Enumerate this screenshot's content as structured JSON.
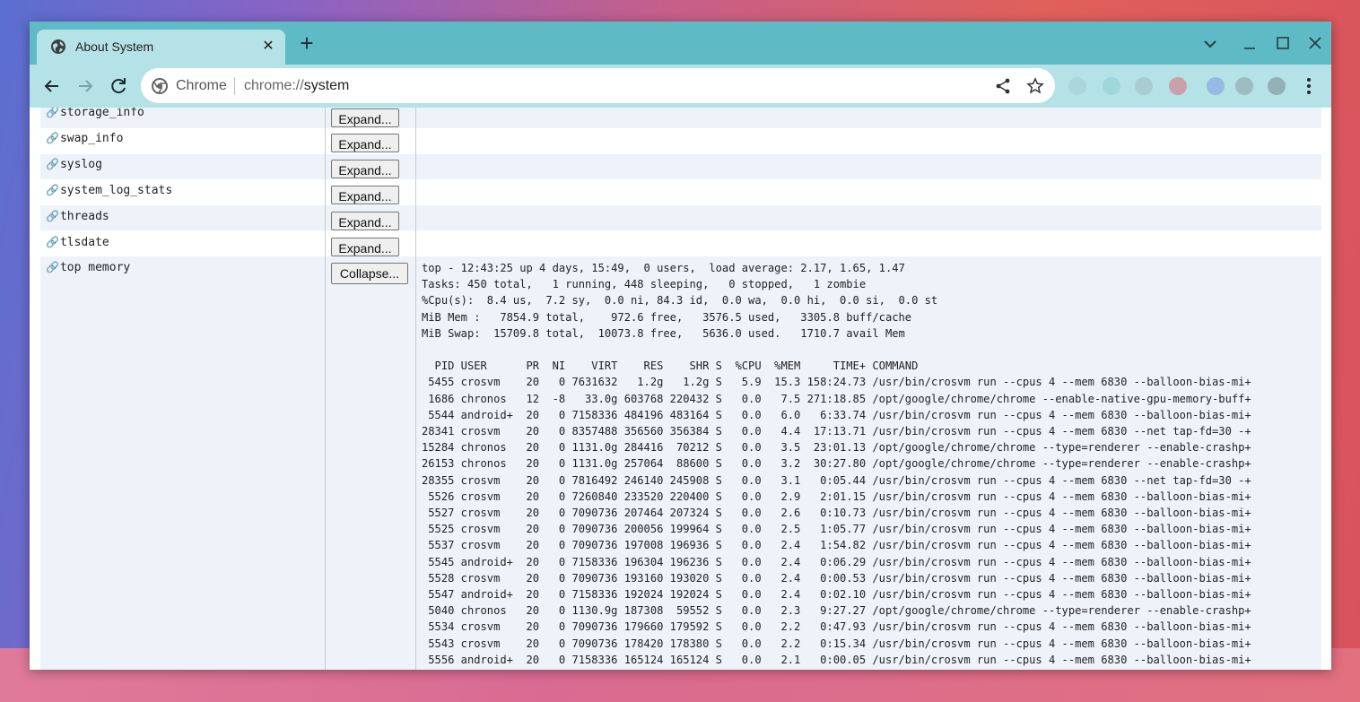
{
  "browser": {
    "tab_title": "About System",
    "tab_close": "✕",
    "new_tab": "+",
    "chip_label": "Chrome",
    "url_scheme": "chrome://",
    "url_host": "system"
  },
  "rows": [
    {
      "name": "storage_info",
      "button": "Expand..."
    },
    {
      "name": "swap_info",
      "button": "Expand..."
    },
    {
      "name": "syslog",
      "button": "Expand..."
    },
    {
      "name": "system_log_stats",
      "button": "Expand..."
    },
    {
      "name": "threads",
      "button": "Expand..."
    },
    {
      "name": "tlsdate",
      "button": "Expand..."
    },
    {
      "name": "top memory",
      "button": "Collapse..."
    }
  ],
  "top_memory": {
    "summary": [
      "top - 12:43:25 up 4 days, 15:49,  0 users,  load average: 2.17, 1.65, 1.47",
      "Tasks: 450 total,   1 running, 448 sleeping,   0 stopped,   1 zombie",
      "%Cpu(s):  8.4 us,  7.2 sy,  0.0 ni, 84.3 id,  0.0 wa,  0.0 hi,  0.0 si,  0.0 st",
      "MiB Mem :   7854.9 total,    972.6 free,   3576.5 used,   3305.8 buff/cache",
      "MiB Swap:  15709.8 total,  10073.8 free,   5636.0 used.   1710.7 avail Mem"
    ],
    "header": "  PID USER      PR  NI    VIRT    RES    SHR S  %CPU  %MEM     TIME+ COMMAND",
    "processes": [
      " 5455 crosvm    20   0 7631632   1.2g   1.2g S   5.9  15.3 158:24.73 /usr/bin/crosvm run --cpus 4 --mem 6830 --balloon-bias-mi+",
      " 1686 chronos   12  -8   33.0g 603768 220432 S   0.0   7.5 271:18.85 /opt/google/chrome/chrome --enable-native-gpu-memory-buff+",
      " 5544 android+  20   0 7158336 484196 483164 S   0.0   6.0   6:33.74 /usr/bin/crosvm run --cpus 4 --mem 6830 --balloon-bias-mi+",
      "28341 crosvm    20   0 8357488 356560 356384 S   0.0   4.4  17:13.71 /usr/bin/crosvm run --cpus 4 --mem 6830 --net tap-fd=30 -+",
      "15284 chronos   20   0 1131.0g 284416  70212 S   0.0   3.5  23:01.13 /opt/google/chrome/chrome --type=renderer --enable-crashp+",
      "26153 chronos   20   0 1131.0g 257064  88600 S   0.0   3.2  30:27.80 /opt/google/chrome/chrome --type=renderer --enable-crashp+",
      "28355 crosvm    20   0 7816492 246140 245908 S   0.0   3.1   0:05.44 /usr/bin/crosvm run --cpus 4 --mem 6830 --net tap-fd=30 -+",
      " 5526 crosvm    20   0 7260840 233520 220400 S   0.0   2.9   2:01.15 /usr/bin/crosvm run --cpus 4 --mem 6830 --balloon-bias-mi+",
      " 5527 crosvm    20   0 7090736 207464 207324 S   0.0   2.6   0:10.73 /usr/bin/crosvm run --cpus 4 --mem 6830 --balloon-bias-mi+",
      " 5525 crosvm    20   0 7090736 200056 199964 S   0.0   2.5   1:05.77 /usr/bin/crosvm run --cpus 4 --mem 6830 --balloon-bias-mi+",
      " 5537 crosvm    20   0 7090736 197008 196936 S   0.0   2.4   1:54.82 /usr/bin/crosvm run --cpus 4 --mem 6830 --balloon-bias-mi+",
      " 5545 android+  20   0 7158336 196304 196236 S   0.0   2.4   0:06.29 /usr/bin/crosvm run --cpus 4 --mem 6830 --balloon-bias-mi+",
      " 5528 crosvm    20   0 7090736 193160 193020 S   0.0   2.4   0:00.53 /usr/bin/crosvm run --cpus 4 --mem 6830 --balloon-bias-mi+",
      " 5547 android+  20   0 7158336 192024 192024 S   0.0   2.4   0:02.10 /usr/bin/crosvm run --cpus 4 --mem 6830 --balloon-bias-mi+",
      " 5040 chronos   20   0 1130.9g 187308  59552 S   0.0   2.3   9:27.27 /opt/google/chrome/chrome --type=renderer --enable-crashp+",
      " 5534 crosvm    20   0 7090736 179660 179592 S   0.0   2.2   0:47.93 /usr/bin/crosvm run --cpus 4 --mem 6830 --balloon-bias-mi+",
      " 5543 crosvm    20   0 7090736 178420 178380 S   0.0   2.2   0:15.34 /usr/bin/crosvm run --cpus 4 --mem 6830 --balloon-bias-mi+",
      " 5556 android+  20   0 7158336 165124 165124 S   0.0   2.1   0:00.05 /usr/bin/crosvm run --cpus 4 --mem 6830 --balloon-bias-mi+"
    ]
  },
  "colors": {
    "tabstrip": "#5ebac5",
    "toolbar": "#b5e2e6",
    "row_shade": "#eef3fa"
  }
}
